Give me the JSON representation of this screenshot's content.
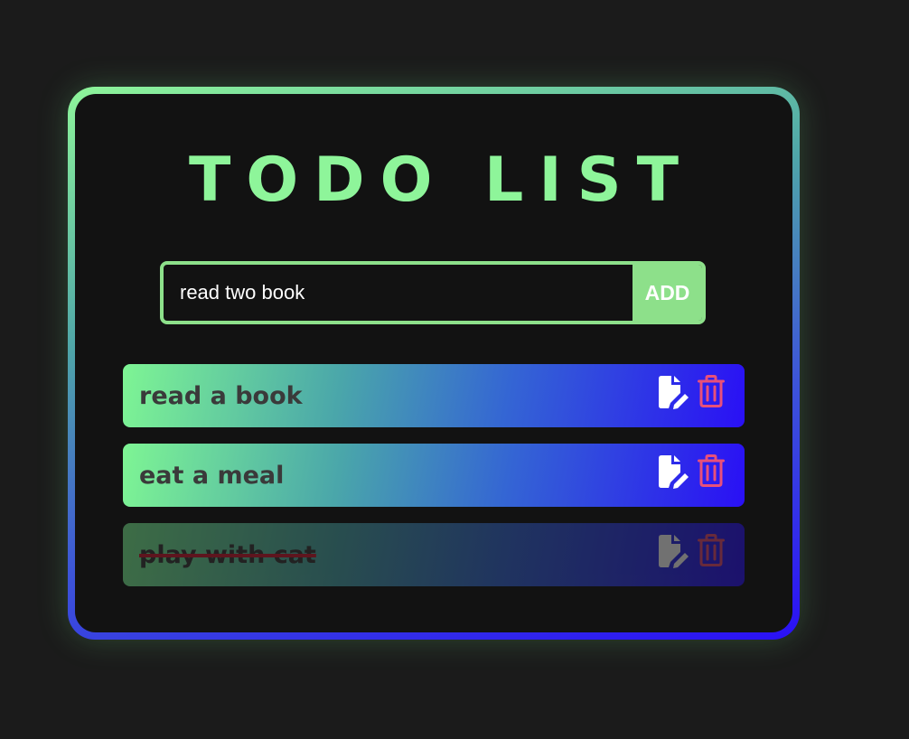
{
  "app": {
    "title": "TODO LIST"
  },
  "form": {
    "input_value": "read two book",
    "add_label": "ADD"
  },
  "todos": [
    {
      "text": "read a book",
      "completed": false
    },
    {
      "text": "eat a meal",
      "completed": false
    },
    {
      "text": "play with cat",
      "completed": true
    }
  ],
  "colors": {
    "accent_green": "#8ef59a",
    "accent_blue": "#2a10f5",
    "edit_icon": "#ffffff",
    "delete_icon": "#e8507a",
    "background": "#1b1b1b",
    "card": "#121212"
  },
  "icons": {
    "edit": "edit-document-icon",
    "delete": "trash-icon"
  }
}
